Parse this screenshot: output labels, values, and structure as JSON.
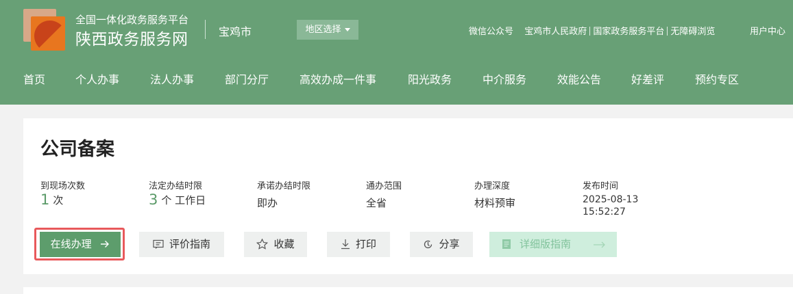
{
  "header": {
    "platform_name": "全国一体化政务服务平台",
    "site_title": "陕西政务服务网",
    "city": "宝鸡市",
    "region_select_label": "地区选择",
    "top_links": [
      "微信公众号",
      "宝鸡市人民政府",
      "国家政务服务平台",
      "无障碍浏览"
    ],
    "user_center": "用户中心"
  },
  "nav": {
    "items": [
      "首页",
      "个人办事",
      "法人办事",
      "部门分厅",
      "高效办成一件事",
      "阳光政务",
      "中介服务",
      "效能公告",
      "好差评",
      "预约专区"
    ]
  },
  "main": {
    "title": "公司备案",
    "info": [
      {
        "label": "到现场次数",
        "number": "1",
        "unit": "次"
      },
      {
        "label": "法定办结时限",
        "number": "3",
        "unit": "个 工作日"
      },
      {
        "label": "承诺办结时限",
        "value": "即办"
      },
      {
        "label": "通办范围",
        "value": "全省"
      },
      {
        "label": "办理深度",
        "value": "材料预审"
      },
      {
        "label": "发布时间",
        "date": "2025-08-13",
        "time": "15:52:27"
      }
    ],
    "buttons": {
      "online": "在线办理",
      "evaluate": "评价指南",
      "favorite": "收藏",
      "print": "打印",
      "share": "分享",
      "detail": "详细版指南"
    }
  },
  "colors": {
    "header_bg": "#68a076",
    "primary_button": "#5d9d6c",
    "highlight_border": "#e8595b",
    "detail_button_bg": "#cfeedd"
  }
}
